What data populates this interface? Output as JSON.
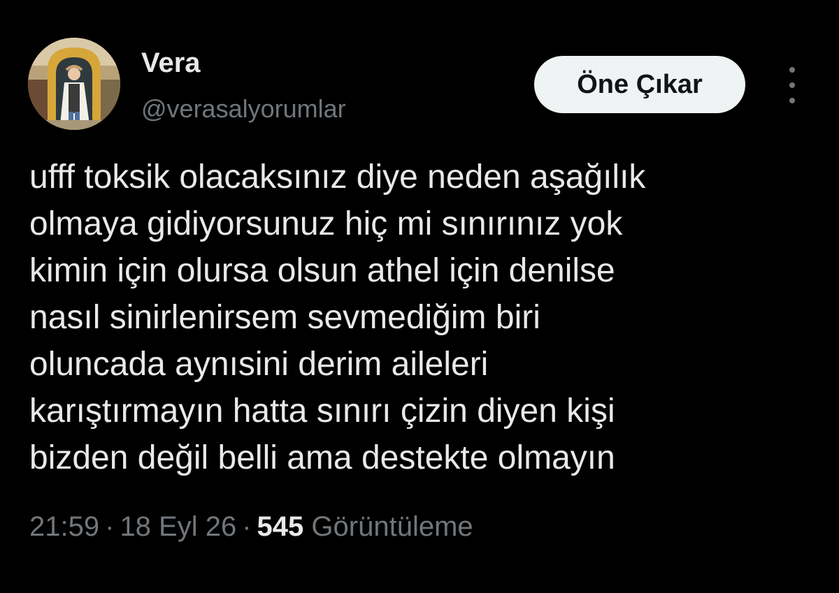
{
  "author": {
    "display_name": "Vera",
    "handle": "@verasalyorumlar"
  },
  "actions": {
    "highlight_label": "Öne Çıkar",
    "more_icon": "more-vertical-icon"
  },
  "tweet": {
    "text": "ufff toksik olacaksınız diye neden aşağılık\nolmaya gidiyorsunuz hiç mi sınırınız yok\nkimin için olursa olsun athel için denilse\nnasıl sinirlenirsem sevmediğim biri\noluncada aynısini derim aileleri\nkarıştırmayın hatta sınırı çizin diyen kişi\nbizden değil belli ama destekte olmayın"
  },
  "meta": {
    "time": "21:59",
    "separator": "·",
    "date": "18 Eyl 26",
    "views_count": "545",
    "views_label": "Görüntüleme"
  },
  "colors": {
    "background": "#000000",
    "primary_text": "#e7e9ea",
    "secondary_text": "#71767b",
    "button_bg": "#eff3f4",
    "button_text": "#0f1419"
  }
}
